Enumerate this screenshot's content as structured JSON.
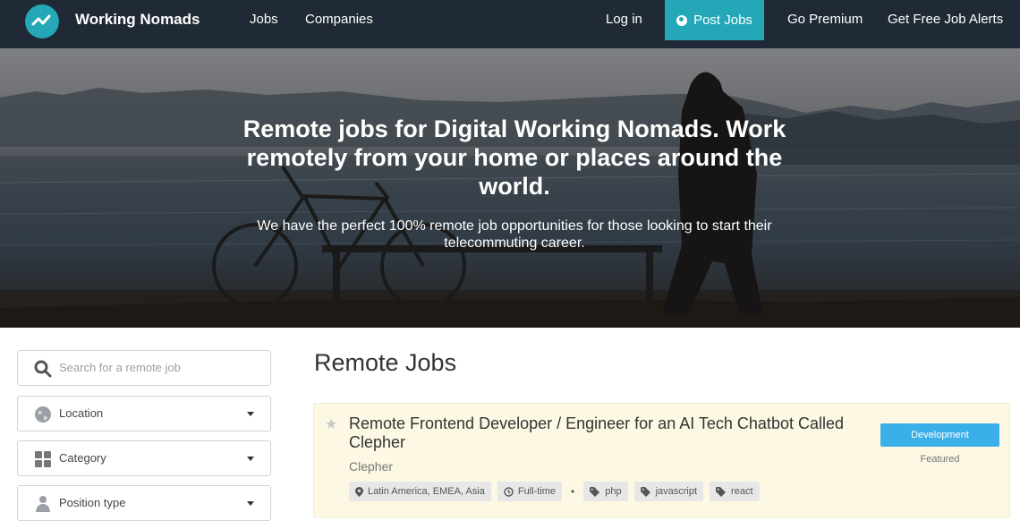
{
  "nav": {
    "brand": "Working Nomads",
    "links": [
      "Jobs",
      "Companies"
    ],
    "right": {
      "login": "Log in",
      "post_jobs": "Post Jobs",
      "premium": "Go Premium",
      "alerts": "Get Free Job Alerts"
    }
  },
  "hero": {
    "title": "Remote jobs for Digital Working Nomads. Work remotely from your home or places around the world.",
    "subtitle": "We have the perfect 100% remote job opportunities for those looking to start their telecommuting career."
  },
  "sidebar": {
    "search_placeholder": "Search for a remote job",
    "location": "Location",
    "category": "Category",
    "position_type": "Position type"
  },
  "main": {
    "title": "Remote Jobs",
    "job": {
      "title": "Remote Frontend Developer / Engineer for an AI Tech Chatbot Called Clepher",
      "company": "Clepher",
      "location": "Latin America, EMEA, Asia",
      "type": "Full-time",
      "tags": [
        "php",
        "javascript",
        "react"
      ],
      "category": "Development",
      "featured": "Featured"
    }
  },
  "colors": {
    "nav_bg": "#202a36",
    "accent": "#24a8b7",
    "category_badge": "#3bb0e8",
    "featured_card": "#fcf8e3"
  }
}
